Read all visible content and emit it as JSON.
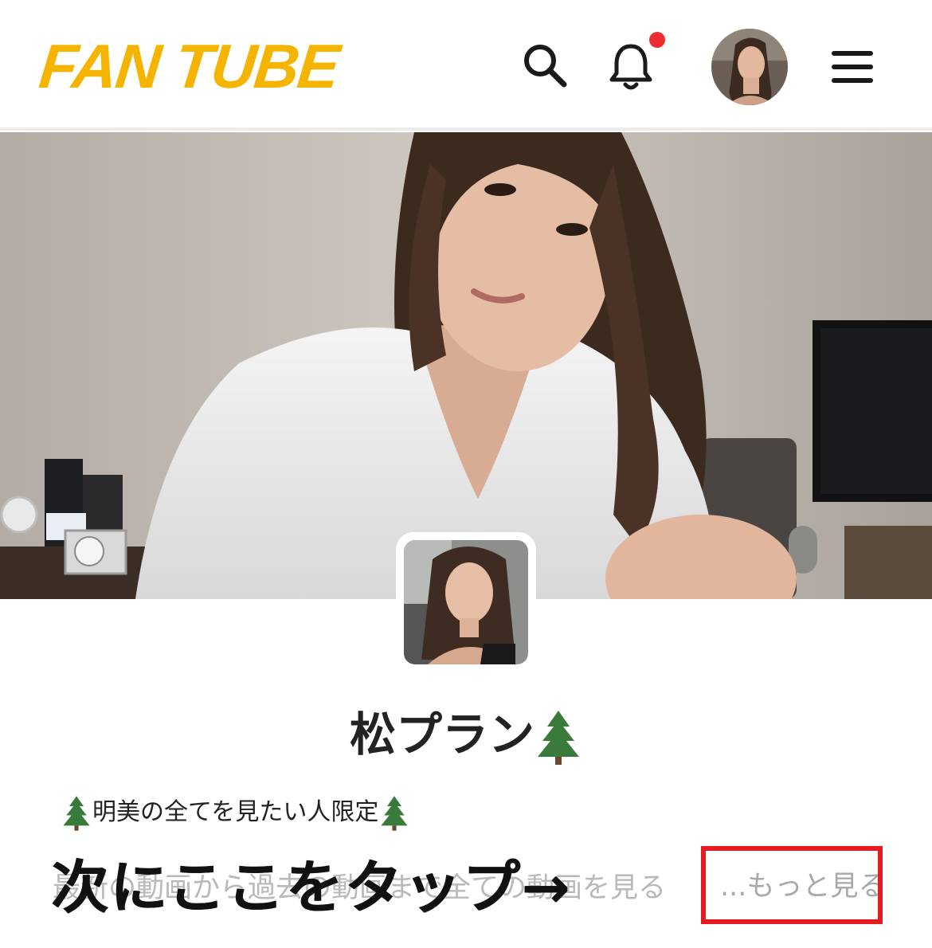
{
  "header": {
    "logo": "FAN TUBE",
    "icons": [
      "search-icon",
      "bell-icon",
      "menu-icon"
    ],
    "has_notification": true
  },
  "profile": {
    "name": "松プラン",
    "name_emoji": "🌲",
    "tagline": "明美の全てを見たい人限定",
    "description": "最新の動画から過去の動画まで全ての動画を見る",
    "more_link": "...もっと見る"
  },
  "annotation": {
    "text": "次にここをタップ→",
    "highlight_color": "#e41b20"
  },
  "colors": {
    "brand": "#f5b400",
    "notification": "#ef2b33"
  }
}
